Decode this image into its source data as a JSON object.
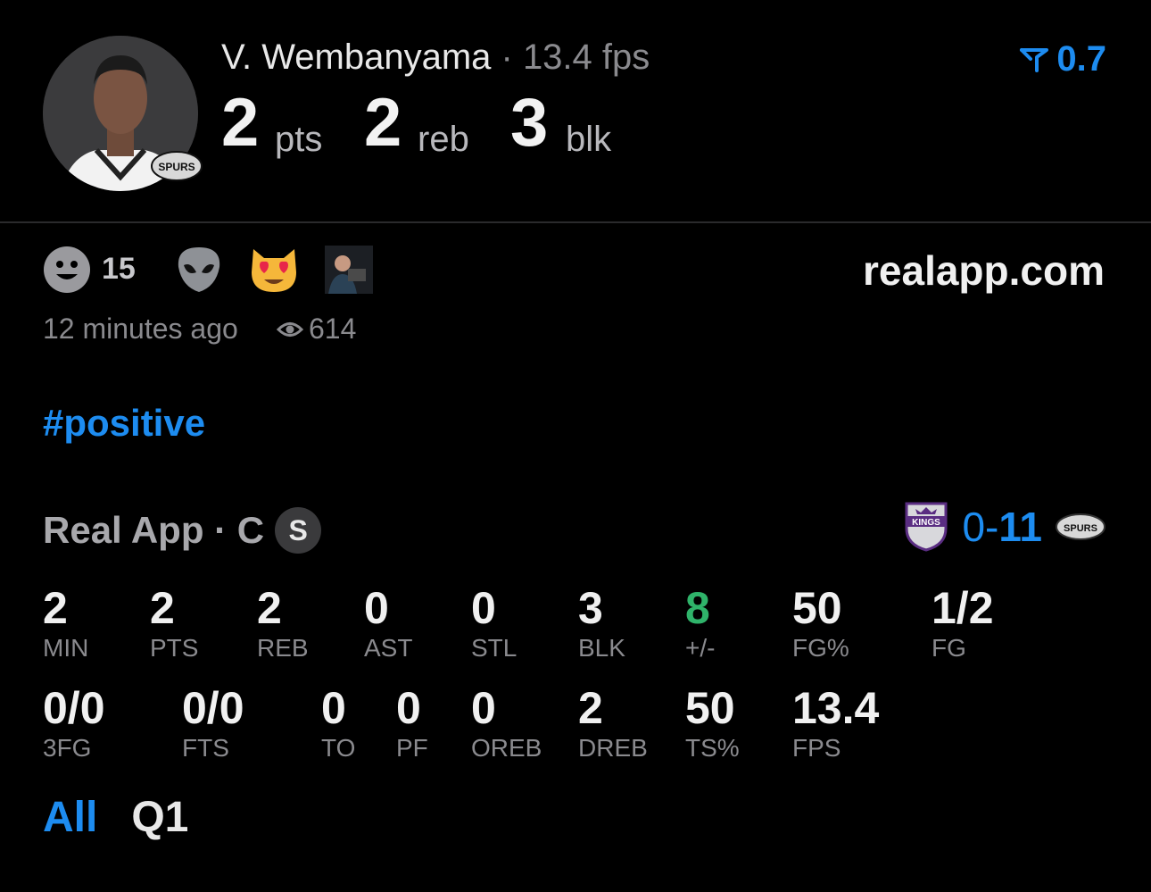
{
  "player": {
    "name": "V. Wembanyama",
    "separator": " · ",
    "fps_text": "13.4 fps",
    "team_logo_text": "SPURS"
  },
  "headline": [
    {
      "value": "2",
      "unit": "pts"
    },
    {
      "value": "2",
      "unit": "reb"
    },
    {
      "value": "3",
      "unit": "blk"
    }
  ],
  "top_score": {
    "value": "0.7",
    "color": "#1d8cf0"
  },
  "reactions": {
    "count": "15",
    "icons": [
      "smiley-icon",
      "alien-icon",
      "heart-eyes-cat-icon",
      "user-thumbnail"
    ]
  },
  "site": "realapp.com",
  "post": {
    "time": "12 minutes ago",
    "views": "614",
    "hashtag": "#positive"
  },
  "game": {
    "source": "Real App · C",
    "badge": "S",
    "score_away": "0",
    "score_dash": "-",
    "score_home": "11",
    "away_logo_text": "KINGS",
    "home_logo_text": "SPURS"
  },
  "stats_row1": [
    {
      "value": "2",
      "label": "MIN"
    },
    {
      "value": "2",
      "label": "PTS"
    },
    {
      "value": "2",
      "label": "REB"
    },
    {
      "value": "0",
      "label": "AST"
    },
    {
      "value": "0",
      "label": "STL"
    },
    {
      "value": "3",
      "label": "BLK"
    },
    {
      "value": "8",
      "label": "+/-"
    },
    {
      "value": "50",
      "label": "FG%"
    },
    {
      "value": "1/2",
      "label": "FG"
    }
  ],
  "stats_row2": [
    {
      "value": "0/0",
      "label": "3FG"
    },
    {
      "value": "0/0",
      "label": "FTS"
    },
    {
      "value": "0",
      "label": "TO"
    },
    {
      "value": "0",
      "label": "PF"
    },
    {
      "value": "0",
      "label": "OREB"
    },
    {
      "value": "2",
      "label": "DREB"
    },
    {
      "value": "50",
      "label": "TS%"
    },
    {
      "value": "13.4",
      "label": "FPS"
    }
  ],
  "tabs": {
    "all": "All",
    "q1": "Q1"
  },
  "colors": {
    "accent": "#1d8cf0",
    "positive": "#2fb36a",
    "muted": "#8a8a8e"
  }
}
